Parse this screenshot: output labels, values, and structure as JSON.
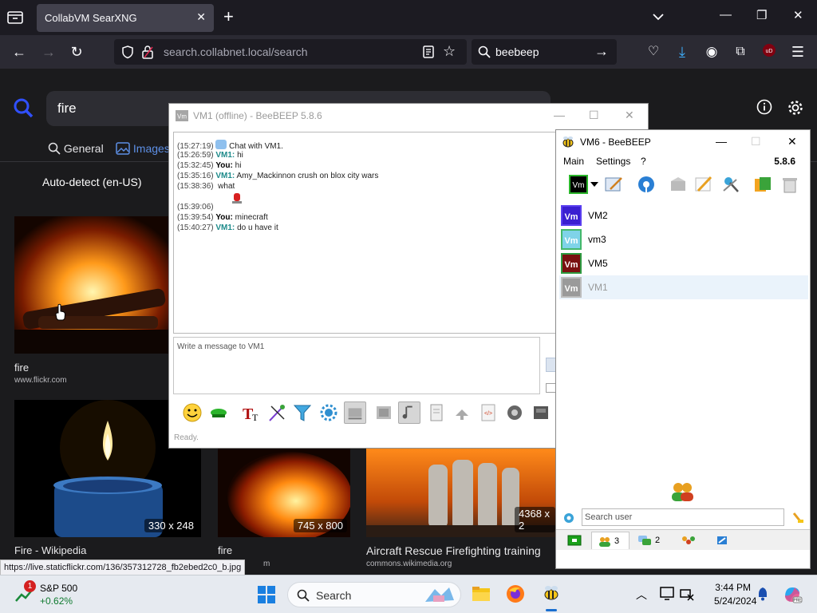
{
  "browser": {
    "tab_title": "CollabVM SearXNG",
    "url": "search.collabnet.local/search",
    "search_query": "beebeep",
    "status_url": "https://live.staticflickr.com/136/357312728_fb2ebed2c0_b.jpg"
  },
  "searx": {
    "query": "fire",
    "tabs": [
      {
        "label": "General"
      },
      {
        "label": "Images"
      }
    ],
    "language": "Auto-detect (en-US)",
    "results": [
      {
        "title": "fire",
        "source": "www.flickr.com",
        "dim": ""
      },
      {
        "title": "Fire - Wikipedia",
        "source": "",
        "dim": "330 x 248"
      },
      {
        "title": "fire",
        "source": "m",
        "dim": "745 x 800"
      },
      {
        "title": "Aircraft Rescue Firefighting training",
        "source": "commons.wikimedia.org",
        "dim": "4368 x 2"
      }
    ]
  },
  "vm1_window": {
    "title": "VM1 (offline) - BeeBEEP 5.8.6",
    "messages": [
      {
        "ts": "(15:27:19)",
        "who": "",
        "text": "Chat with VM1."
      },
      {
        "ts": "(15:26:59)",
        "who": "VM1:",
        "text": "hi"
      },
      {
        "ts": "(15:32:45)",
        "who": "You:",
        "text": "hi"
      },
      {
        "ts": "(15:35:16)",
        "who": "VM1:",
        "text": "Amy_Mackinnon crush on blox city wars"
      },
      {
        "ts": "(15:38:36)",
        "who": "",
        "text": "what"
      },
      {
        "ts": "(15:39:06)",
        "who": "",
        "text": ""
      },
      {
        "ts": "(15:39:54)",
        "who": "You:",
        "text": "minecraft"
      },
      {
        "ts": "(15:40:27)",
        "who": "VM1:",
        "text": "do u have it"
      }
    ],
    "input_placeholder": "Write a message to VM1",
    "status": "Ready."
  },
  "vm6_window": {
    "title": "VM6 - BeeBEEP",
    "menu": [
      "Main",
      "Settings",
      "?"
    ],
    "version": "5.8.6",
    "users": [
      {
        "name": "VM2",
        "avatar": "Vm",
        "color": "#3a1fd1",
        "border": "#5a3ff0",
        "offline": false
      },
      {
        "name": "vm3",
        "avatar": "Vm",
        "color": "#7fd3e8",
        "border": "#43b86a",
        "offline": false
      },
      {
        "name": "VM5",
        "avatar": "Vm",
        "color": "#7a1010",
        "border": "#2e9a40",
        "offline": false
      },
      {
        "name": "VM1",
        "avatar": "Vm",
        "color": "#9a9a9a",
        "border": "#bdbdbd",
        "offline": true
      }
    ],
    "search_placeholder": "Search user",
    "tabs": [
      {
        "label": "3"
      },
      {
        "label": "2"
      },
      {
        "label": ""
      },
      {
        "label": ""
      }
    ]
  },
  "taskbar": {
    "stock_name": "S&P 500",
    "stock_change": "+0.62%",
    "stock_badge": "1",
    "search_label": "Search",
    "time": "3:44 PM",
    "date": "5/24/2024"
  }
}
